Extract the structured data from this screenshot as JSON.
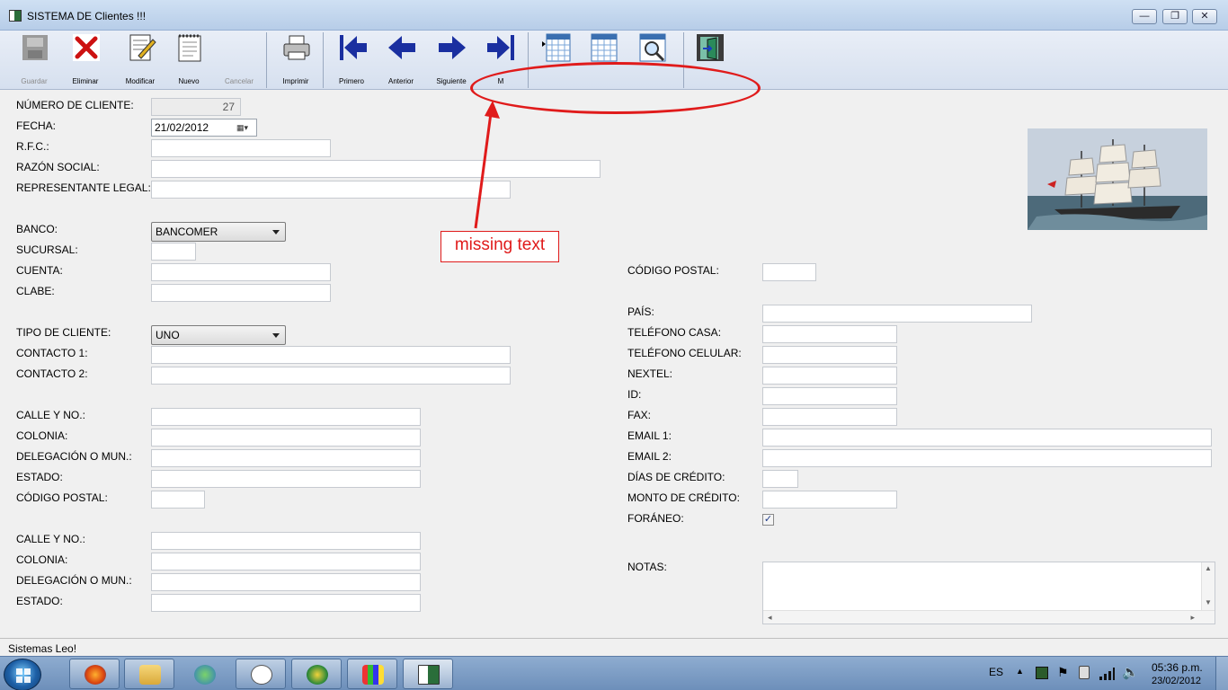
{
  "window": {
    "title": "SISTEMA DE Clientes !!!",
    "min_glyph": "—",
    "restore_glyph": "❐",
    "close_glyph": "✕"
  },
  "toolbar": {
    "guardar": "Guardar",
    "eliminar": "Eliminar",
    "modificar": "Modificar",
    "nuevo": "Nuevo",
    "cancelar": "Cancelar",
    "imprimir": "Imprimir",
    "primero": "Primero",
    "anterior": "Anterior",
    "siguiente": "Siguiente",
    "m": "M"
  },
  "form": {
    "numero_cliente_label": "NÚMERO DE CLIENTE:",
    "numero_cliente_value": "27",
    "fecha_label": "FECHA:",
    "fecha_value": "21/02/2012",
    "rfc_label": "R.F.C.:",
    "razon_label": "RAZÓN SOCIAL:",
    "representante_label": "REPRESENTANTE LEGAL:",
    "banco_label": "BANCO:",
    "banco_value": "BANCOMER",
    "sucursal_label": "SUCURSAL:",
    "cuenta_label": "CUENTA:",
    "clabe_label": "CLABE:",
    "tipo_label": "TIPO DE CLIENTE:",
    "tipo_value": "UNO",
    "contacto1_label": "CONTACTO 1:",
    "contacto2_label": "CONTACTO 2:",
    "calle1_label": "CALLE Y NO.:",
    "colonia1_label": "COLONIA:",
    "delegacion1_label": "DELEGACIÓN O MUN.:",
    "estado1_label": "ESTADO:",
    "cp1_label": "CÓDIGO POSTAL:",
    "calle2_label": "CALLE Y NO.:",
    "colonia2_label": "COLONIA:",
    "delegacion2_label": "DELEGACIÓN O MUN.:",
    "estado2_label": "ESTADO:",
    "cp2_label": "CÓDIGO POSTAL:",
    "pais_label": "PAÍS:",
    "tel_casa_label": "TELÉFONO CASA:",
    "tel_cel_label": "TELÉFONO CELULAR:",
    "nextel_label": "NEXTEL:",
    "id_label": "ID:",
    "fax_label": "FAX:",
    "email1_label": "EMAIL 1:",
    "email2_label": "EMAIL 2:",
    "dias_label": "DÍAS DE CRÉDITO:",
    "monto_label": "MONTO DE CRÉDITO:",
    "foraneo_label": "FORÁNEO:",
    "foraneo_checked": true,
    "notas_label": "NOTAS:"
  },
  "annotation": {
    "text": "missing text",
    "color": "#e01b1b"
  },
  "status": {
    "text": "Sistemas Leo!"
  },
  "taskbar": {
    "lang": "ES",
    "time": "05:36 p.m.",
    "date": "23/02/2012"
  }
}
